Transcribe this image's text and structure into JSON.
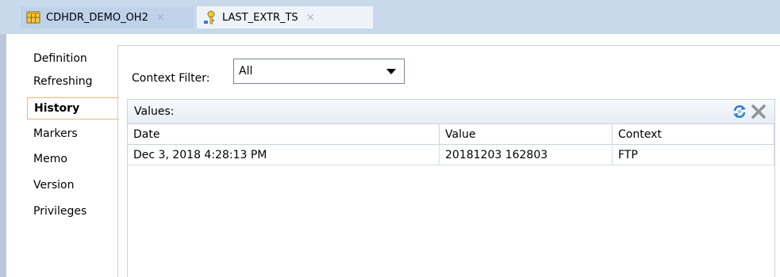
{
  "tabs": [
    {
      "label": "CDHDR_DEMO_OH2",
      "icon": "table-icon",
      "close": "×"
    },
    {
      "label": "LAST_EXTR_TS",
      "icon": "variable-key-icon",
      "close": "×"
    }
  ],
  "sidenav": {
    "items": [
      "Definition",
      "Refreshing",
      "History",
      "Markers",
      "Memo",
      "Version",
      "Privileges"
    ],
    "active": "History"
  },
  "context_filter": {
    "label": "Context Filter:",
    "value": "All"
  },
  "values": {
    "title": "Values:",
    "columns": [
      "Date",
      "Value",
      "Context"
    ],
    "rows": [
      [
        "Dec 3, 2018 4:28:13 PM",
        "20181203 162803",
        "FTP"
      ]
    ]
  },
  "colors": {
    "tabstrip": "#c9d9ec",
    "active_nav_border": "#f3b473"
  }
}
